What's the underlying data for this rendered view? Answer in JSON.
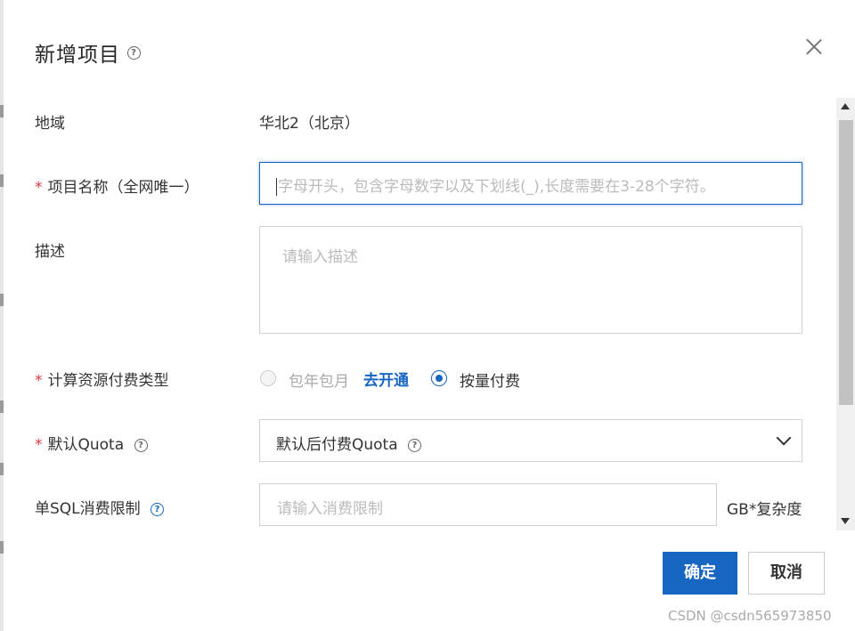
{
  "dialog": {
    "title": "新增项目",
    "help_glyph": "?"
  },
  "form": {
    "region": {
      "label": "地域",
      "value": "华北2（北京）"
    },
    "project_name": {
      "required_mark": "*",
      "label": "项目名称（全网唯一）",
      "placeholder": "字母开头，包含字母数字以及下划线(_),长度需要在3-28个字符。",
      "value": ""
    },
    "description": {
      "label": "描述",
      "placeholder": "请输入描述",
      "value": ""
    },
    "billing_type": {
      "required_mark": "*",
      "label": "计算资源付费类型",
      "options": [
        {
          "label": "包年包月",
          "state": "disabled"
        },
        {
          "label": "按量付费",
          "state": "selected"
        }
      ],
      "activate_link": "去开通"
    },
    "default_quota": {
      "required_mark": "*",
      "label": "默认Quota",
      "selected": "默认后付费Quota"
    },
    "sql_limit": {
      "label": "单SQL消费限制",
      "placeholder": "请输入消费限制",
      "suffix": "GB*复杂度"
    }
  },
  "footer": {
    "confirm_label": "确定",
    "cancel_label": "取消"
  },
  "watermark": "CSDN @csdn565973850",
  "colors": {
    "primary": "#1766c2",
    "required": "#d9363e",
    "link": "#1766c2"
  }
}
